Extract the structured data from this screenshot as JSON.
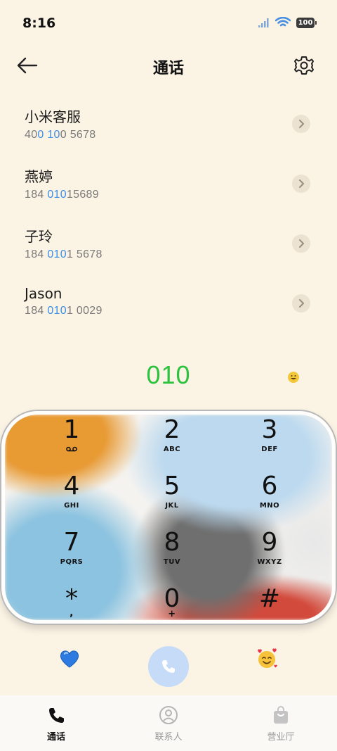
{
  "status_bar": {
    "time": "8:16",
    "battery": "100",
    "icons": [
      "signal-icon",
      "wifi-icon",
      "battery-icon"
    ]
  },
  "header": {
    "title": "通话",
    "back_icon": "arrow-left-icon",
    "settings_icon": "gear-icon"
  },
  "contacts": [
    {
      "name": "小米客服",
      "number_parts": [
        "40",
        "0 10",
        "0 5678"
      ]
    },
    {
      "name": "燕婷",
      "number_parts": [
        "184 ",
        "010",
        "15689"
      ]
    },
    {
      "name": "子玲",
      "number_parts": [
        "184 ",
        "010",
        "1 5678"
      ]
    },
    {
      "name": "Jason",
      "number_parts": [
        "184 ",
        "010",
        "1 0029"
      ]
    }
  ],
  "dial": {
    "number": "010",
    "color": "#2cc23e"
  },
  "keypad": [
    {
      "digit": "1",
      "letters": "voicemail"
    },
    {
      "digit": "2",
      "letters": "ABC"
    },
    {
      "digit": "3",
      "letters": "DEF"
    },
    {
      "digit": "4",
      "letters": "GHI"
    },
    {
      "digit": "5",
      "letters": "JKL"
    },
    {
      "digit": "6",
      "letters": "MNO"
    },
    {
      "digit": "7",
      "letters": "PQRS"
    },
    {
      "digit": "8",
      "letters": "TUV"
    },
    {
      "digit": "9",
      "letters": "WXYZ"
    },
    {
      "digit": "*",
      "letters": ","
    },
    {
      "digit": "0",
      "letters": "+"
    },
    {
      "digit": "#",
      "letters": ""
    }
  ],
  "actions": {
    "left_icon": "blue-heart-icon",
    "call_icon": "phone-icon",
    "right_icon": "smiling-face-with-hearts-icon",
    "call_color": "#c6dbf7"
  },
  "tabs": [
    {
      "label": "通话",
      "icon": "phone-icon",
      "active": true
    },
    {
      "label": "联系人",
      "icon": "person-icon",
      "active": false
    },
    {
      "label": "营业厅",
      "icon": "shopping-bag-icon",
      "active": false
    }
  ],
  "colors": {
    "background": "#fbf3e4",
    "highlight": "#3c8ee6"
  }
}
